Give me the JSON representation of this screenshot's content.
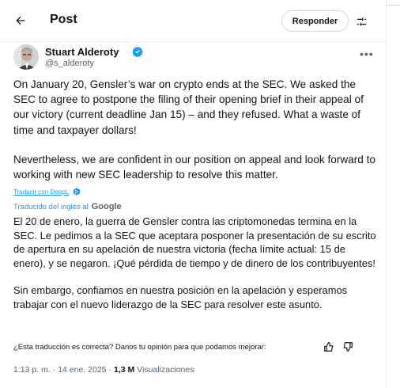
{
  "header": {
    "title": "Post",
    "reply_label": "Responder",
    "back_icon": "arrow-left-icon",
    "options_icon": "sliders-icon"
  },
  "author": {
    "name": "Stuart Alderoty",
    "handle": "@s_alderoty",
    "verified_icon": "verified-badge-icon",
    "more_icon": "more-horizontal-icon"
  },
  "tweet": {
    "paragraph1": "On January 20, Gensler’s war on crypto ends at the SEC. We asked the SEC to agree to postpone the filing of their opening brief in their appeal of our victory (current deadline Jan 15) – and they refused. What a waste of time and taxpayer dollars!",
    "paragraph2": "Nevertheless, we are confident in our position on appeal and look forward to working with new SEC leadership to resolve this matter."
  },
  "translation_bar": {
    "deepl_link": "Traducir con DeepL",
    "translated_from": "Traducido del inglés al",
    "google": "Google"
  },
  "translation": {
    "paragraph1": "El 20 de enero, la guerra de Gensler contra las criptomonedas termina en la SEC. Le pedimos a la SEC que aceptara posponer la presentación de su escrito de apertura en su apelación de nuestra victoria (fecha límite actual: 15 de enero), y se negaron. ¡Qué pérdida de tiempo y de dinero de los contribuyentes!",
    "paragraph2": "Sin embargo, confiamos en nuestra posición en la apelación y esperamos trabajar con el nuevo liderazgo de la SEC para resolver este asunto."
  },
  "feedback": {
    "question": "¿Esta traducción es correcta? Danos tu opinión para que podamos mejorar:"
  },
  "meta": {
    "time": "1:13 p. m.",
    "separator1": "·",
    "date": "14 ene. 2025",
    "separator2": "·",
    "views_count": "1,3 M",
    "views_label": "Visualizaciones"
  },
  "colors": {
    "accent": "#1d9bf0",
    "text": "#0f1419",
    "secondary_text": "#536471",
    "border": "#cfd9de"
  }
}
